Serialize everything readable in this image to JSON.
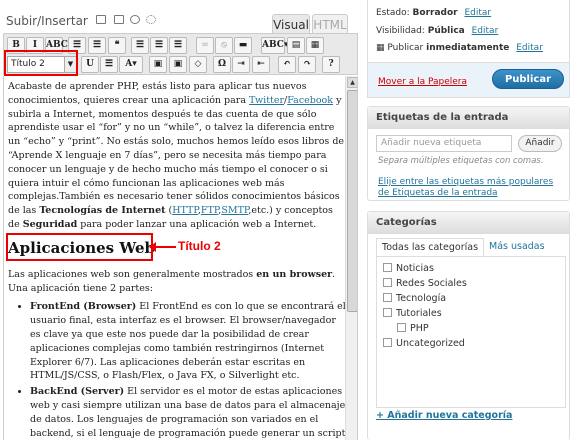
{
  "upload": {
    "label": "Subir/Insertar"
  },
  "tabs": {
    "visual": "Visual",
    "html": "HTML"
  },
  "toolbar": {
    "row1": [
      "B",
      "I",
      "ABC",
      "☰",
      "☰",
      "❝",
      "☰",
      "☰",
      "☰",
      "∞",
      "⦸",
      "▬",
      "ABC▾",
      "▤",
      "▦"
    ],
    "format_value": "Título 2",
    "row2": [
      "U",
      "☰",
      "A▾",
      "▣",
      "▣",
      "◇",
      "Ω",
      "⇥",
      "⇤",
      "↶",
      "↷",
      "?"
    ]
  },
  "annotation": {
    "label": "Título 2"
  },
  "editor": {
    "p1": [
      {
        "t": "Acabaste de aprender PHP, estás listo para aplicar tus nuevos conocimientos, quieres crear una aplicación para "
      },
      {
        "t": "Twitter",
        "link": true
      },
      {
        "t": "/"
      },
      {
        "t": "Facebook",
        "link": true
      },
      {
        "t": " y subirla a Internet, momentos después te das cuenta de que sólo aprendiste usar el “for” y no un “while”, o talvez la diferencia entre un “echo” y “print”. No estás solo, muchos hemos leído esos libros de “Aprende X lenguaje en 7 días”, pero se necesita más tiempo para conocer un lenguaje y de hecho mucho más tiempo el conocer o si quiera intuir el cómo funcionan las aplicaciones web más complejas.También es necesario tener sólidos conocimientos básicos de las "
      },
      {
        "t": "Tecnologías de Internet",
        "b": true
      },
      {
        "t": " ("
      },
      {
        "t": "HTTP",
        "link": true
      },
      {
        "t": ","
      },
      {
        "t": "FTP",
        "link": true
      },
      {
        "t": ","
      },
      {
        "t": "SMTP",
        "link": true
      },
      {
        "t": ",etc.) y conceptos de "
      },
      {
        "t": "Seguridad",
        "b": true
      },
      {
        "t": " para poder lanzar una aplicación web a Internet."
      }
    ],
    "heading": "Aplicaciones Web",
    "p2": [
      {
        "t": "Las aplicaciones web son generalmente mostrados "
      },
      {
        "t": "en un browser",
        "b": true
      },
      {
        "t": ". Una aplicación tiene 2 partes:"
      }
    ],
    "bullets": [
      [
        {
          "t": "FrontEnd (Browser)",
          "b": true
        },
        {
          "t": " El FrontEnd es con lo que se encontrará el usuario final, esta interfaz es el browser. El browser/navegador es clave ya que este nos puede dar la posibilidad de crear aplicaciones complejas como también restringirnos (Internet Explorer 6/7). Las aplicaciones deberán estar escritas en HTML/JS/CSS, o Flash/Flex, o Java FX, o Silverlight etc."
        }
      ],
      [
        {
          "t": "BackEnd (Server)",
          "b": true
        },
        {
          "t": " El servidor es el motor de estas aplicaciones web y casi siempre utilizan una base de datos para el almacenaje de datos. Los lenguajes de programación son variados en el backend, si el lenguaje de programación puede generar un script HTML entonces ya"
        }
      ]
    ]
  },
  "publish": {
    "status_label": "Estado:",
    "status_value": "Borrador",
    "visibility_label": "Visibilidad:",
    "visibility_value": "Pública",
    "schedule_prefix": "Publicar",
    "schedule_value": "inmediatamente",
    "edit": "Editar",
    "trash": "Mover a la Papelera",
    "publish_button": "Publicar"
  },
  "tags": {
    "title": "Etiquetas de la entrada",
    "placeholder": "Añadir nueva etiqueta",
    "add_button": "Añadir",
    "hint": "Separa múltiples etiquetas con comas.",
    "popular_link": "Elije entre las etiquetas más populares de Etiquetas de la entrada"
  },
  "categories": {
    "title": "Categorías",
    "tab_all": "Todas las categorías",
    "tab_used": "Más usadas",
    "items": [
      {
        "label": "Noticias",
        "sub": false
      },
      {
        "label": "Redes Sociales",
        "sub": false
      },
      {
        "label": "Tecnología",
        "sub": false
      },
      {
        "label": "Tutoriales",
        "sub": false
      },
      {
        "label": "PHP",
        "sub": true
      },
      {
        "label": "Uncategorized",
        "sub": false
      }
    ],
    "add_link": "+ Añadir nueva categoría"
  }
}
